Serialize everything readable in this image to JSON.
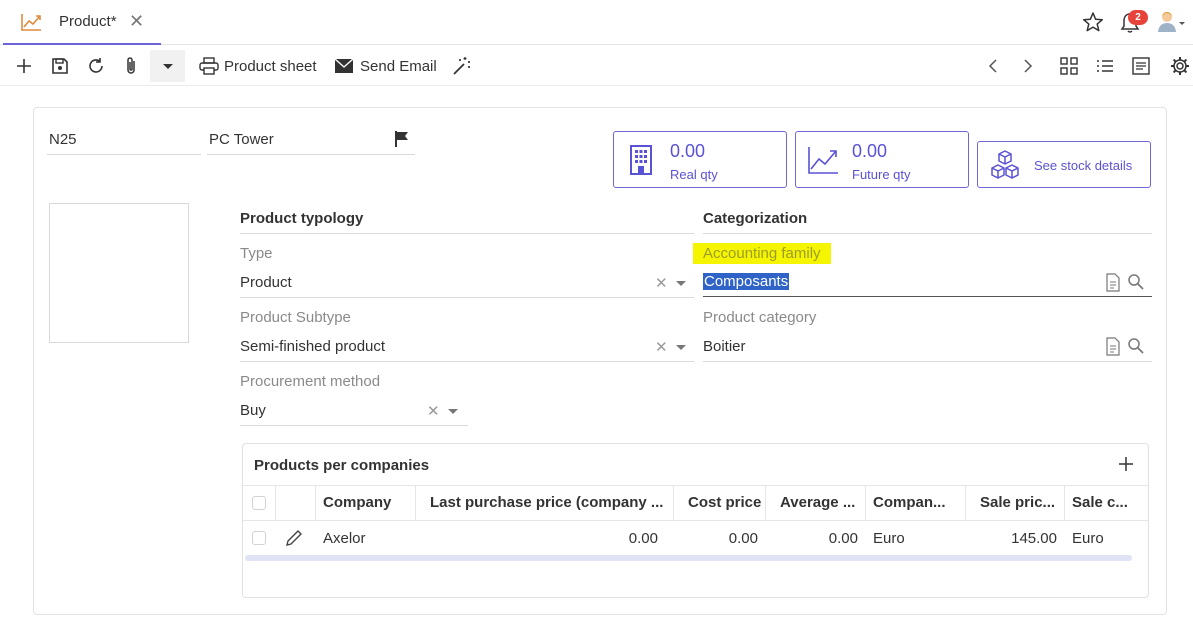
{
  "tab": {
    "title": "Product*",
    "icon": "trend-chart-icon"
  },
  "header": {
    "notification_count": "2"
  },
  "toolbar": {
    "product_sheet_label": "Product sheet",
    "send_email_label": "Send Email"
  },
  "product": {
    "code": "N25",
    "name": "PC Tower"
  },
  "stats": {
    "real_qty_value": "0.00",
    "real_qty_label": "Real qty",
    "future_qty_value": "0.00",
    "future_qty_label": "Future qty",
    "stock_details_label": "See stock details"
  },
  "typology": {
    "section_title": "Product typology",
    "type_label": "Type",
    "type_value": "Product",
    "subtype_label": "Product Subtype",
    "subtype_value": "Semi-finished product",
    "procurement_label": "Procurement method",
    "procurement_value": "Buy"
  },
  "categorization": {
    "section_title": "Categorization",
    "accounting_family_label": "Accounting family",
    "accounting_family_value": "Composants",
    "category_label": "Product category",
    "category_value": "Boitier"
  },
  "companies_grid": {
    "title": "Products per companies",
    "columns": [
      "Company",
      "Last purchase price (company ...",
      "Cost price",
      "Average ...",
      "Compan...",
      "Sale pric...",
      "Sale c..."
    ],
    "rows": [
      {
        "company": "Axelor",
        "last_purchase_price": "0.00",
        "cost_price": "0.00",
        "average": "0.00",
        "company_currency": "Euro",
        "sale_price": "145.00",
        "sale_currency": "Euro"
      }
    ]
  },
  "colors": {
    "accent": "#5a52d5",
    "highlight": "#f5f500",
    "selection": "#2f63c8",
    "badge": "#e8433b"
  }
}
